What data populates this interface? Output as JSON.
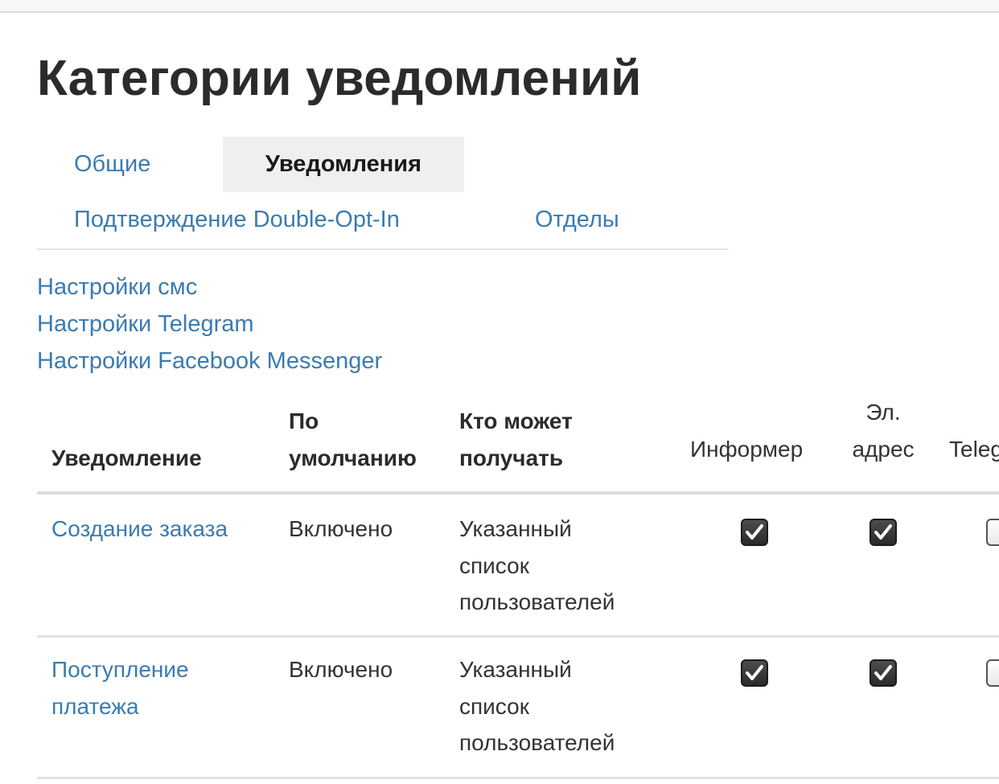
{
  "page": {
    "title": "Категории уведомлений"
  },
  "tabs": [
    {
      "label": "Общие",
      "active": false
    },
    {
      "label": "Уведомления",
      "active": true
    },
    {
      "label": "Подтверждение Double-Opt-In",
      "active": false
    },
    {
      "label": "Отделы",
      "active": false
    }
  ],
  "links": [
    {
      "label": "Настройки смс"
    },
    {
      "label": "Настройки Telegram"
    },
    {
      "label": "Настройки Facebook Messenger"
    }
  ],
  "table": {
    "headers": {
      "notification": "Уведомление",
      "default_line1": "По",
      "default_line2": "умолчанию",
      "who_line1": "Кто может",
      "who_line2": "получать",
      "informer": "Информер",
      "email_line1": "Эл.",
      "email_line2": "адрес",
      "telegram": "Telegram"
    },
    "rows": [
      {
        "name_line1": "Создание заказа",
        "name_line2": "",
        "default": "Включено",
        "who_line1": "Указанный",
        "who_line2": "список",
        "who_line3": "пользователей",
        "informer": true,
        "email": true,
        "telegram": false
      },
      {
        "name_line1": "Поступление",
        "name_line2": "платежа",
        "default": "Включено",
        "who_line1": "Указанный",
        "who_line2": "список",
        "who_line3": "пользователей",
        "informer": true,
        "email": true,
        "telegram": false
      }
    ]
  },
  "colors": {
    "link": "#3b7bb0",
    "text": "#333333",
    "active_tab_bg": "#efefef",
    "checkbox_checked": "#3a3a3a"
  }
}
